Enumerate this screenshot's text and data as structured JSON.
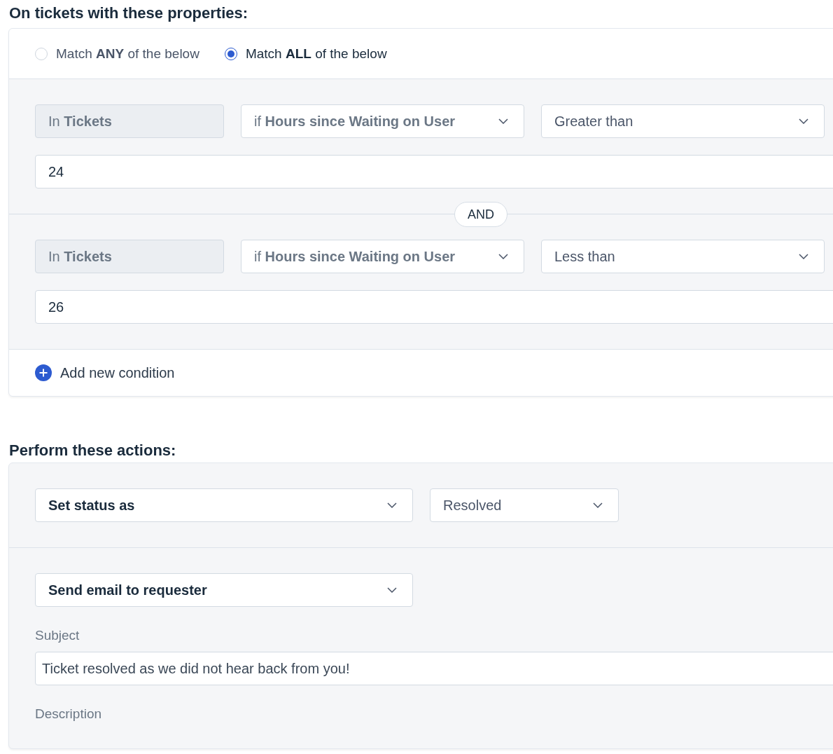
{
  "conditions_section": {
    "heading": "On tickets with these properties:",
    "match_options": [
      {
        "label": "Match **ANY** of the below",
        "selected": false
      },
      {
        "label": "Match **ALL** of the below",
        "selected": true
      }
    ],
    "conditions": [
      {
        "scope": "In **Tickets**",
        "field": "if **Hours since Waiting on User**",
        "operator": "Greater than",
        "value": "24"
      },
      {
        "scope": "In **Tickets**",
        "field": "if **Hours since Waiting on User**",
        "operator": "Less than",
        "value": "26"
      }
    ],
    "connector": "AND",
    "add_condition": "Add new condition"
  },
  "actions_section": {
    "heading": "Perform these actions:",
    "actions": [
      {
        "kind": "status",
        "action": "Set status as",
        "value": "Resolved"
      },
      {
        "kind": "email",
        "action": "Send email to requester",
        "subject_label": "Subject",
        "subject": "Ticket resolved as we did not hear back from you!",
        "description_label": "Description"
      }
    ]
  }
}
